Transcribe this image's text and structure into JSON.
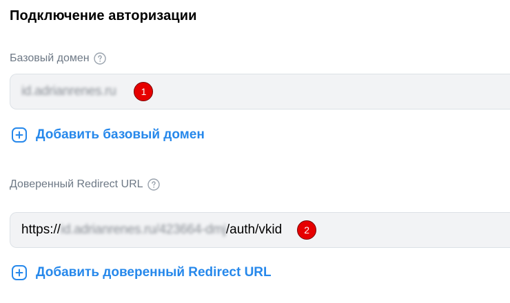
{
  "section": {
    "title": "Подключение авторизации"
  },
  "base_domain": {
    "label": "Базовый домен",
    "value_blurred": "id.adrianrenes.ru",
    "badge": "1",
    "add_label": "Добавить базовый домен"
  },
  "redirect_url": {
    "label": "Доверенный Redirect URL",
    "value_prefix": "https://",
    "value_blurred": "id.adrianrenes.ru/423664-dmj",
    "value_suffix": "/auth/vkid",
    "badge": "2",
    "add_label": "Добавить доверенный Redirect URL"
  },
  "icons": {
    "help": "help-circle-icon",
    "add": "add-square-icon"
  },
  "colors": {
    "accent": "#2688eb",
    "label": "#6d7885",
    "input_bg": "#f2f3f5",
    "badge": "#e60000"
  }
}
